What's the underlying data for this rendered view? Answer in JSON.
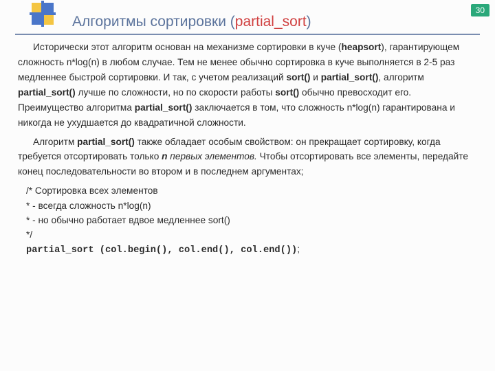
{
  "page_number": "30",
  "title": {
    "main": "Алгоритмы  сортировки  ",
    "paren_open": "(",
    "red": "partial_sort",
    "paren_close": ")"
  },
  "para1": {
    "t1": "Исторически этот алгоритм основан на механизме сортировки в куче (",
    "b1": "heapsort",
    "t2": "), гарантирующем сложность n*log(n) в любом случае. Тем не менее обычно сортировка в куче выполняется в 2-5 раз медленнее быстрой сортировки. И так, с учетом реализаций ",
    "b2": "sort()",
    "t3": " и ",
    "b3": "partial_sort()",
    "t4": ", алгоритм ",
    "b4": "partial_sort()",
    "t5": " лучше по сложности, но по скорости работы ",
    "b5": "sort()",
    "t6": " обычно превосходит его. Преимущество алгоритма ",
    "b6": "partial_sort()",
    "t7": " заключается в том, что сложность n*log(n) гарантирована и никогда не ухудшается до квадратичной сложности."
  },
  "para2": {
    "t1": "Алгоритм ",
    "b1": "partial_sort()",
    "t2": " также обладает особым свойством: он прекращает сортировку, когда требуется отсортировать только ",
    "bi1": "n",
    "it1": " первых элементов.",
    "t3": " Чтобы отсортировать все элементы, передайте конец последовательности во втором и в последнем аргументах;"
  },
  "code": {
    "l1": "/* Сортировка всех элементов",
    "l2": "* - всегда сложность n*log(n)",
    "l3": "* - но обычно работает вдвое медленнее sort()",
    "l4": "*/",
    "l5": "partial_sort (col.begin(), col.end(), col.end())",
    "l5b": ";"
  }
}
